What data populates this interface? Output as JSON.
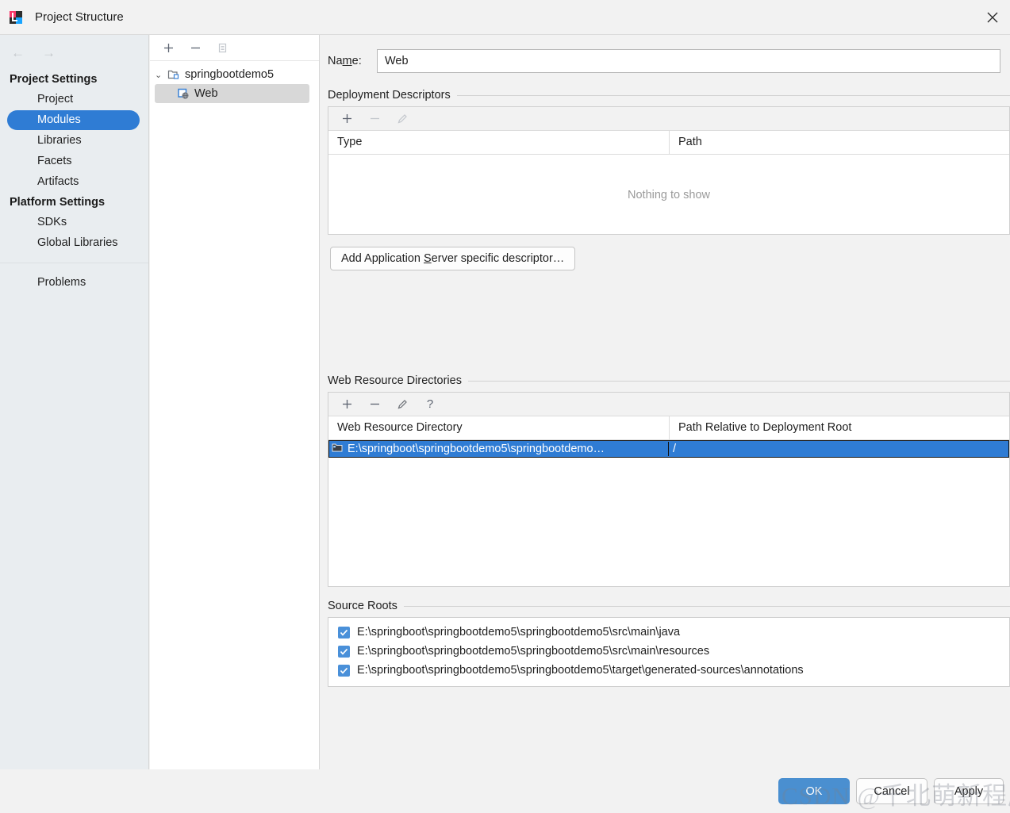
{
  "window": {
    "title": "Project Structure",
    "app_icon": "intellij-idea-icon",
    "close_icon": "close-icon"
  },
  "sidebar": {
    "back_icon": "←",
    "forward_icon": "→",
    "groups": [
      {
        "label": "Project Settings",
        "items": [
          {
            "label": "Project",
            "selected": false
          },
          {
            "label": "Modules",
            "selected": true
          },
          {
            "label": "Libraries",
            "selected": false
          },
          {
            "label": "Facets",
            "selected": false
          },
          {
            "label": "Artifacts",
            "selected": false
          }
        ]
      },
      {
        "label": "Platform Settings",
        "items": [
          {
            "label": "SDKs",
            "selected": false
          },
          {
            "label": "Global Libraries",
            "selected": false
          }
        ]
      }
    ],
    "standalone_item": "Problems",
    "selection_color": "#2f7cd4"
  },
  "help_button": {
    "label": "?"
  },
  "tree_panel": {
    "toolbar": [
      {
        "name": "add-module-button",
        "glyph": "+",
        "enabled": true
      },
      {
        "name": "remove-module-button",
        "glyph": "−",
        "enabled": true
      },
      {
        "name": "copy-module-button",
        "glyph": "copy",
        "enabled": false
      }
    ],
    "nodes": [
      {
        "label": "springbootdemo5",
        "type": "module",
        "expanded": true,
        "selected": false,
        "chevron": "⌄"
      },
      {
        "label": "Web",
        "type": "facet-web",
        "selected": true
      }
    ]
  },
  "main": {
    "name_field": {
      "label_before": "Na",
      "label_mnemonic": "m",
      "label_after": "e:",
      "value": "Web"
    },
    "deployment_descriptors": {
      "title": "Deployment Descriptors",
      "toolbar": [
        {
          "name": "add-descriptor-icon",
          "glyph": "+",
          "enabled": true
        },
        {
          "name": "remove-descriptor-icon",
          "glyph": "−",
          "enabled": false
        },
        {
          "name": "edit-descriptor-icon",
          "glyph": "pencil",
          "enabled": false
        }
      ],
      "columns": [
        "Type",
        "Path"
      ],
      "rows": [],
      "empty_text": "Nothing to show",
      "add_button": {
        "text_before": "Add Application ",
        "mnemonic": "S",
        "text_after": "erver specific descriptor…"
      }
    },
    "web_resource_directories": {
      "title": "Web Resource Directories",
      "toolbar": [
        {
          "name": "add-web-resource-icon",
          "glyph": "+",
          "enabled": true
        },
        {
          "name": "remove-web-resource-icon",
          "glyph": "−",
          "enabled": true
        },
        {
          "name": "edit-web-resource-icon",
          "glyph": "pencil",
          "enabled": true
        },
        {
          "name": "web-resource-help-icon",
          "glyph": "?",
          "enabled": true
        }
      ],
      "columns": [
        "Web Resource Directory",
        "Path Relative to Deployment Root"
      ],
      "rows": [
        {
          "directory": "E:\\springboot\\springbootdemo5\\springbootdemo…",
          "path": "/",
          "selected": true,
          "icon": "folder-icon"
        }
      ]
    },
    "source_roots": {
      "title": "Source Roots",
      "items": [
        {
          "checked": true,
          "path": "E:\\springboot\\springbootdemo5\\springbootdemo5\\src\\main\\java"
        },
        {
          "checked": true,
          "path": "E:\\springboot\\springbootdemo5\\springbootdemo5\\src\\main\\resources"
        },
        {
          "checked": true,
          "path": "E:\\springboot\\springbootdemo5\\springbootdemo5\\target\\generated-sources\\annotations"
        }
      ]
    }
  },
  "footer": {
    "ok_label": "OK",
    "cancel_label": "Cancel",
    "apply_label": "Apply",
    "ok_color": "#4a8fd0"
  },
  "watermark": {
    "text": "CSDN @千北萌新程序员"
  }
}
